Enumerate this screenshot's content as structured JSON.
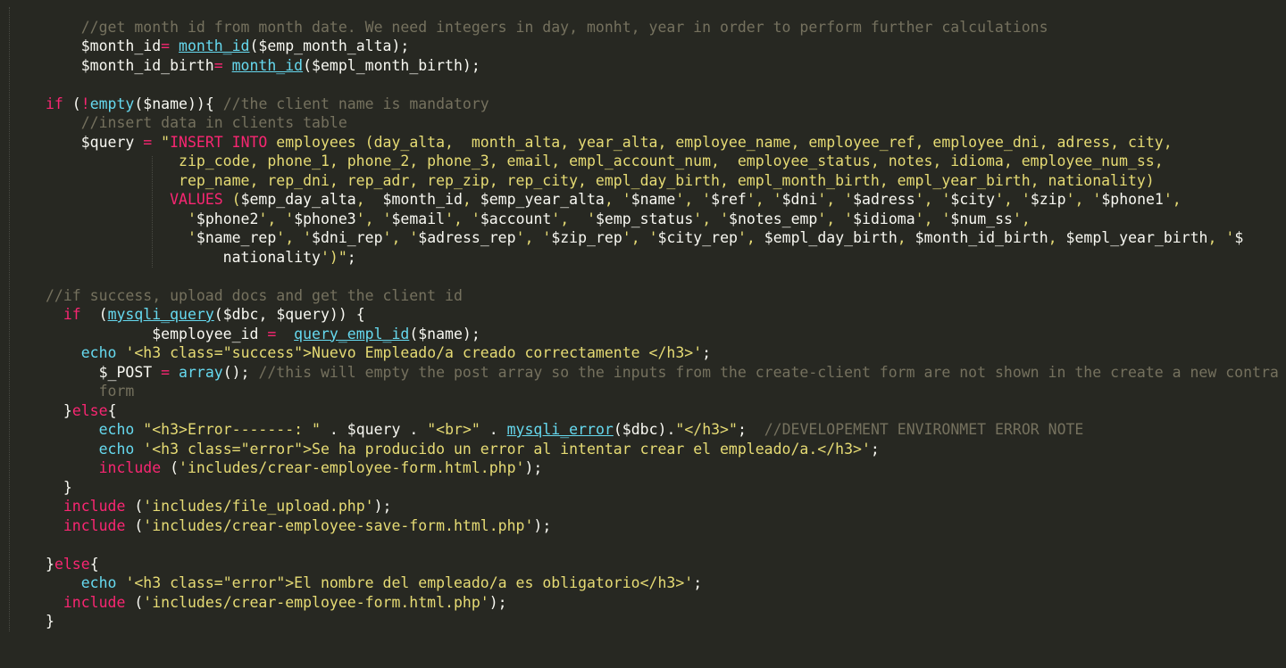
{
  "colors": {
    "background": "#272822",
    "comment": "#75715e",
    "keyword": "#f92672",
    "function": "#66d9ef",
    "string": "#e6db74",
    "default": "#f8f8f2"
  },
  "lines": [
    [
      {
        "t": "    "
      },
      {
        "c": "c",
        "t": "//get month id from month date. We need integers in day, monht, year in order to perform further calculations"
      }
    ],
    [
      {
        "t": "    $month_id"
      },
      {
        "c": "k",
        "t": "="
      },
      {
        "t": " "
      },
      {
        "c": "f u",
        "t": "month_id"
      },
      {
        "t": "($emp_month_alta);"
      }
    ],
    [
      {
        "t": "    $month_id_birth"
      },
      {
        "c": "k",
        "t": "="
      },
      {
        "t": " "
      },
      {
        "c": "f u",
        "t": "month_id"
      },
      {
        "t": "($empl_month_birth);"
      }
    ],
    [
      {
        "t": ""
      }
    ],
    [
      {
        "c": "k",
        "t": "if"
      },
      {
        "t": " ("
      },
      {
        "c": "k",
        "t": "!"
      },
      {
        "c": "f",
        "t": "empty"
      },
      {
        "t": "($name)){ "
      },
      {
        "c": "c",
        "t": "//the client name is mandatory"
      }
    ],
    [
      {
        "t": "    "
      },
      {
        "c": "c",
        "t": "//insert data in clients table"
      }
    ],
    [
      {
        "t": "    $query "
      },
      {
        "c": "k",
        "t": "="
      },
      {
        "t": " "
      },
      {
        "c": "s",
        "t": "\""
      },
      {
        "c": "k",
        "t": "INSERT INTO"
      },
      {
        "c": "s",
        "t": " employees (day_alta,  month_alta, year_alta, employee_name, employee_ref, employee_dni, adress, city,"
      }
    ],
    [
      {
        "c": "s",
        "t": "               zip_code, phone_1, phone_2, phone_3, email, empl_account_num,  employee_status, notes, idioma, employee_num_ss,"
      }
    ],
    [
      {
        "c": "s",
        "t": "               rep_name, rep_dni, rep_adr, rep_zip, rep_city, empl_day_birth, empl_month_birth, empl_year_birth, nationality)"
      }
    ],
    [
      {
        "c": "s",
        "t": "              "
      },
      {
        "c": "k",
        "t": "VALUES"
      },
      {
        "c": "s",
        "t": " ("
      },
      {
        "t": "$emp_day_alta"
      },
      {
        "c": "s",
        "t": ",  "
      },
      {
        "t": "$month_id"
      },
      {
        "c": "s",
        "t": ", "
      },
      {
        "t": "$emp_year_alta"
      },
      {
        "c": "s",
        "t": ", '"
      },
      {
        "t": "$name"
      },
      {
        "c": "s",
        "t": "', '"
      },
      {
        "t": "$ref"
      },
      {
        "c": "s",
        "t": "', '"
      },
      {
        "t": "$dni"
      },
      {
        "c": "s",
        "t": "', '"
      },
      {
        "t": "$adress"
      },
      {
        "c": "s",
        "t": "', '"
      },
      {
        "t": "$city"
      },
      {
        "c": "s",
        "t": "', '"
      },
      {
        "t": "$zip"
      },
      {
        "c": "s",
        "t": "', '"
      },
      {
        "t": "$phone1"
      },
      {
        "c": "s",
        "t": "',"
      }
    ],
    [
      {
        "c": "s",
        "t": "                '"
      },
      {
        "t": "$phone2"
      },
      {
        "c": "s",
        "t": "', '"
      },
      {
        "t": "$phone3"
      },
      {
        "c": "s",
        "t": "', '"
      },
      {
        "t": "$email"
      },
      {
        "c": "s",
        "t": "', '"
      },
      {
        "t": "$account"
      },
      {
        "c": "s",
        "t": "',  '"
      },
      {
        "t": "$emp_status"
      },
      {
        "c": "s",
        "t": "', '"
      },
      {
        "t": "$notes_emp"
      },
      {
        "c": "s",
        "t": "', '"
      },
      {
        "t": "$idioma"
      },
      {
        "c": "s",
        "t": "', '"
      },
      {
        "t": "$num_ss"
      },
      {
        "c": "s",
        "t": "',"
      }
    ],
    [
      {
        "c": "s",
        "t": "                '"
      },
      {
        "t": "$name_rep"
      },
      {
        "c": "s",
        "t": "', '"
      },
      {
        "t": "$dni_rep"
      },
      {
        "c": "s",
        "t": "', '"
      },
      {
        "t": "$adress_rep"
      },
      {
        "c": "s",
        "t": "', '"
      },
      {
        "t": "$zip_rep"
      },
      {
        "c": "s",
        "t": "', '"
      },
      {
        "t": "$city_rep"
      },
      {
        "c": "s",
        "t": "', "
      },
      {
        "t": "$empl_day_birth"
      },
      {
        "c": "s",
        "t": ", "
      },
      {
        "t": "$month_id_birth"
      },
      {
        "c": "s",
        "t": ", "
      },
      {
        "t": "$empl_year_birth"
      },
      {
        "c": "s",
        "t": ", '"
      },
      {
        "t": "$"
      }
    ],
    [
      {
        "t": "                    nationality"
      },
      {
        "c": "s",
        "t": "')\""
      },
      {
        "t": ";"
      }
    ],
    [
      {
        "t": ""
      }
    ],
    [
      {
        "c": "c",
        "t": "//if success, upload docs and get the client id"
      }
    ],
    [
      {
        "t": "  "
      },
      {
        "c": "k",
        "t": "if"
      },
      {
        "t": "  ("
      },
      {
        "c": "f u",
        "t": "mysqli_query"
      },
      {
        "t": "($dbc, $query)) {"
      }
    ],
    [
      {
        "t": "            $employee_id "
      },
      {
        "c": "k",
        "t": "="
      },
      {
        "t": "  "
      },
      {
        "c": "f u",
        "t": "query_empl_id"
      },
      {
        "t": "($name);"
      }
    ],
    [
      {
        "t": "    "
      },
      {
        "c": "f",
        "t": "echo"
      },
      {
        "t": " "
      },
      {
        "c": "s",
        "t": "'<h3 class=\"success\">Nuevo Empleado/a creado correctamente </h3>'"
      },
      {
        "t": ";"
      }
    ],
    [
      {
        "t": "      $_POST "
      },
      {
        "c": "k",
        "t": "="
      },
      {
        "t": " "
      },
      {
        "c": "f",
        "t": "array"
      },
      {
        "t": "(); "
      },
      {
        "c": "c",
        "t": "//this will empty the post array so the inputs from the create-client form are not shown in the create a new contra"
      }
    ],
    [
      {
        "t": "      "
      },
      {
        "c": "c",
        "t": "form"
      }
    ],
    [
      {
        "t": "  }"
      },
      {
        "c": "k",
        "t": "else"
      },
      {
        "t": "{"
      }
    ],
    [
      {
        "t": "      "
      },
      {
        "c": "f",
        "t": "echo"
      },
      {
        "t": " "
      },
      {
        "c": "s",
        "t": "\"<h3>Error-------: \""
      },
      {
        "t": " . $query . "
      },
      {
        "c": "s",
        "t": "\"<br>\""
      },
      {
        "t": " . "
      },
      {
        "c": "f u",
        "t": "mysqli_error"
      },
      {
        "t": "($dbc)."
      },
      {
        "c": "s",
        "t": "\"</h3>\""
      },
      {
        "t": ";  "
      },
      {
        "c": "c",
        "t": "//DEVELOPEMENT ENVIRONMET ERROR NOTE"
      }
    ],
    [
      {
        "t": "      "
      },
      {
        "c": "f",
        "t": "echo"
      },
      {
        "t": " "
      },
      {
        "c": "s",
        "t": "'<h3 class=\"error\">Se ha producido un error al intentar crear el empleado/a.</h3>'"
      },
      {
        "t": ";"
      }
    ],
    [
      {
        "t": "      "
      },
      {
        "c": "k",
        "t": "include"
      },
      {
        "t": " ("
      },
      {
        "c": "s",
        "t": "'includes/crear-employee-form.html.php'"
      },
      {
        "t": ");"
      }
    ],
    [
      {
        "t": "  }"
      }
    ],
    [
      {
        "t": "  "
      },
      {
        "c": "k",
        "t": "include"
      },
      {
        "t": " ("
      },
      {
        "c": "s",
        "t": "'includes/file_upload.php'"
      },
      {
        "t": ");"
      }
    ],
    [
      {
        "t": "  "
      },
      {
        "c": "k",
        "t": "include"
      },
      {
        "t": " ("
      },
      {
        "c": "s",
        "t": "'includes/crear-employee-save-form.html.php'"
      },
      {
        "t": ");"
      }
    ],
    [
      {
        "t": ""
      }
    ],
    [
      {
        "t": "}"
      },
      {
        "c": "k",
        "t": "else"
      },
      {
        "t": "{"
      }
    ],
    [
      {
        "t": "    "
      },
      {
        "c": "f",
        "t": "echo"
      },
      {
        "t": " "
      },
      {
        "c": "s",
        "t": "'<h3 class=\"error\">El nombre del empleado/a es obligatorio</h3>'"
      },
      {
        "t": ";"
      }
    ],
    [
      {
        "t": "  "
      },
      {
        "c": "k",
        "t": "include"
      },
      {
        "t": " ("
      },
      {
        "c": "s",
        "t": "'includes/crear-employee-form.html.php'"
      },
      {
        "t": ");"
      }
    ],
    [
      {
        "t": "}"
      }
    ]
  ]
}
